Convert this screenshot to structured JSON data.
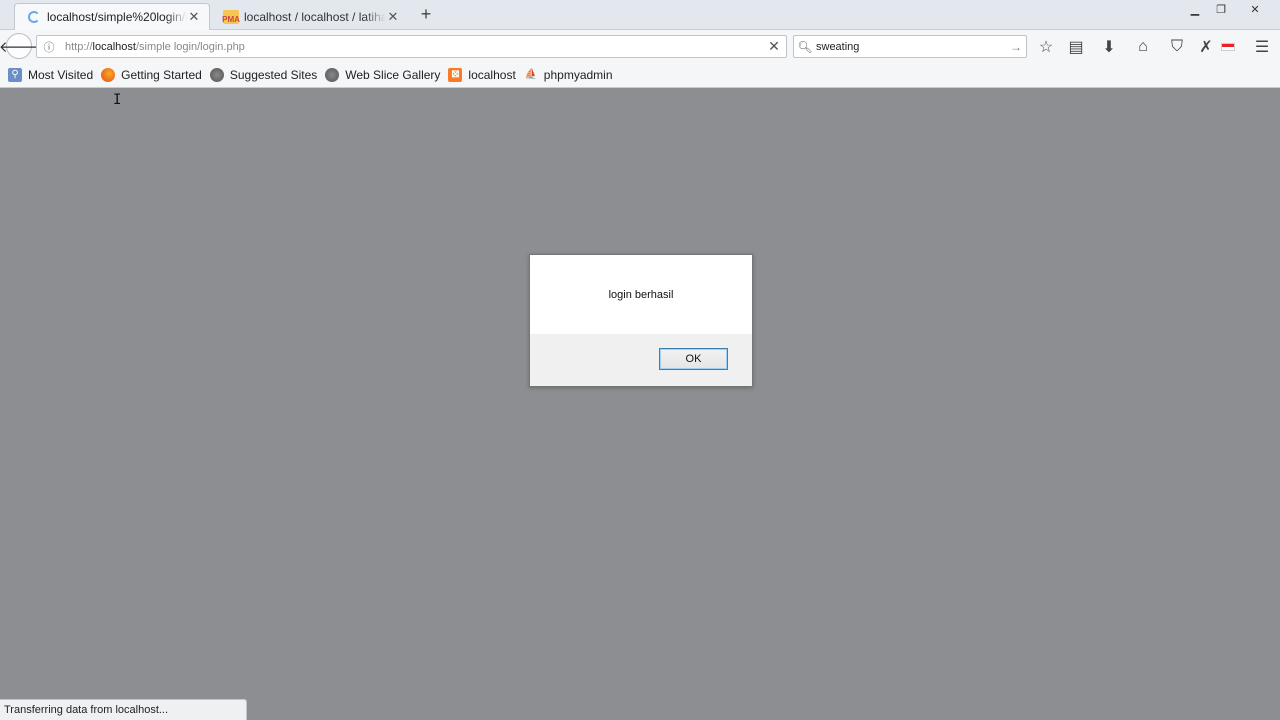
{
  "tabs": [
    {
      "title": "localhost/simple%20login/lo",
      "favicon": "loading-spinner-icon",
      "active": true
    },
    {
      "title": "localhost / localhost / latihan",
      "favicon": "phpmyadmin-icon",
      "active": false
    }
  ],
  "navbar": {
    "url_prefix": "http://",
    "url_host": "localhost",
    "url_path": "/simple login/login.php",
    "search_value": "sweating"
  },
  "bookmarks": [
    {
      "label": "Most Visited",
      "icon": "most-visited-icon"
    },
    {
      "label": "Getting Started",
      "icon": "firefox-icon"
    },
    {
      "label": "Suggested Sites",
      "icon": "globe-icon"
    },
    {
      "label": "Web Slice Gallery",
      "icon": "globe-icon"
    },
    {
      "label": "localhost",
      "icon": "xampp-icon"
    },
    {
      "label": "phpmyadmin",
      "icon": "phpmyadmin-icon"
    }
  ],
  "dialog": {
    "message": "login berhasil",
    "ok_label": "OK"
  },
  "status": {
    "text": "Transferring data from localhost..."
  },
  "colors": {
    "page_overlay": "#8d8e92",
    "dialog_button_border": "#3c7fb1"
  }
}
